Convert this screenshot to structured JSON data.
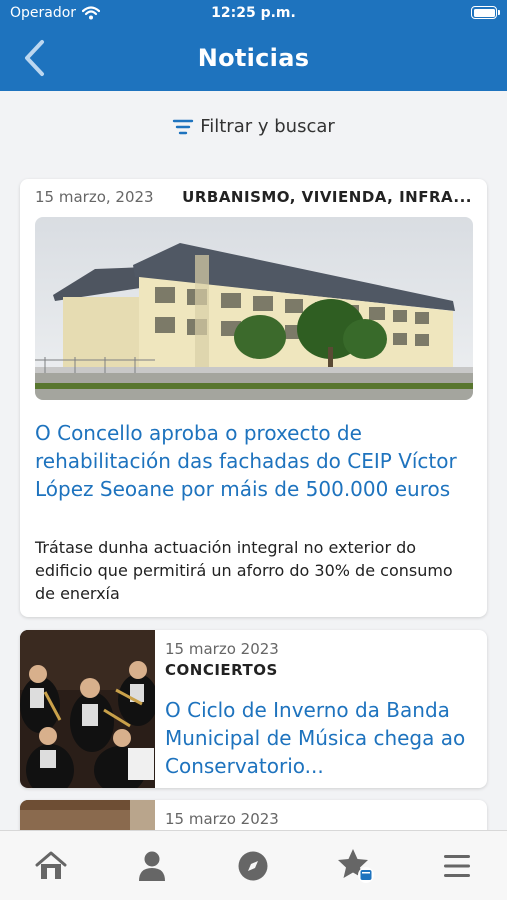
{
  "status_bar": {
    "carrier": "Operador",
    "time": "12:25 p.m.",
    "wifi_icon": "wifi-icon",
    "battery_icon": "battery-icon"
  },
  "header": {
    "title": "Noticias",
    "back_icon": "chevron-left-icon",
    "background": "#1e73be"
  },
  "filter": {
    "label": "Filtrar y buscar",
    "icon": "filter-icon"
  },
  "news": [
    {
      "date": "15 marzo, 2023",
      "category": "URBANISMO, VIVIENDA, INFRA...",
      "title": "O Concello aproba o proxecto de rehabilitación das fachadas do CEIP Víctor López Seoane por máis de 500.000 euros",
      "summary": "Trátase dunha actuación integral no exterior do edificio que permitirá un aforro do 30% de consumo de enerxía",
      "image": "school-building-photo"
    },
    {
      "date": "15 marzo 2023",
      "category": "CONCIERTOS",
      "title": "O Ciclo de Inverno da Banda Municipal de Música chega ao Conservatorio...",
      "image": "band-musicians-photo"
    },
    {
      "date": "15 marzo 2023",
      "image": "news-thumbnail-photo"
    }
  ],
  "tabbar": {
    "items": [
      "home-icon",
      "user-icon",
      "compass-icon",
      "favorites-icon",
      "menu-icon"
    ],
    "icon_color": "#666666"
  },
  "colors": {
    "accent": "#1e73be",
    "background": "#f2f3f5"
  }
}
